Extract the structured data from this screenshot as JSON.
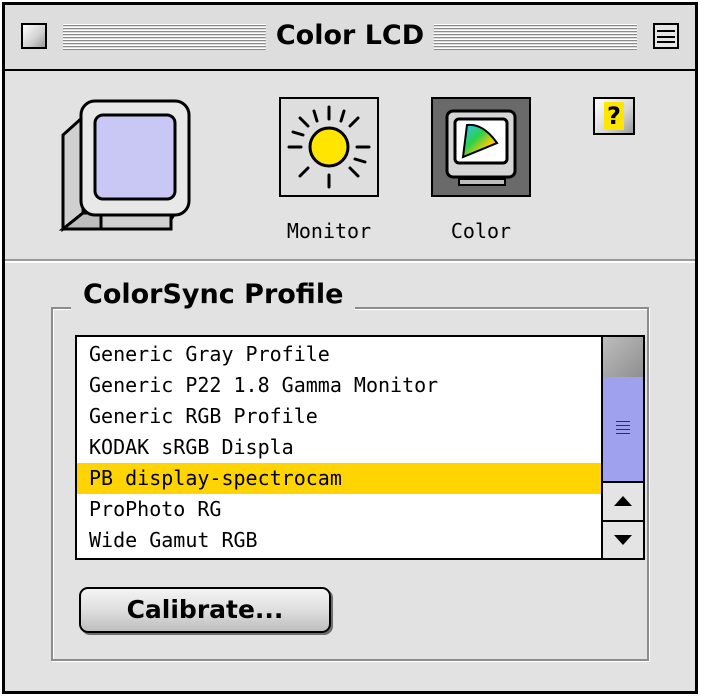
{
  "window": {
    "title": "Color LCD"
  },
  "toolbar": {
    "monitor_label": "Monitor",
    "color_label": "Color",
    "help_label": "?"
  },
  "colorsync": {
    "group_title": "ColorSync Profile",
    "profiles": [
      "Generic Gray Profile",
      "Generic P22 1.8 Gamma Monitor",
      "Generic RGB Profile",
      "KODAK sRGB Displa",
      "PB display-spectrocam",
      "ProPhoto RG",
      "Wide Gamut RGB"
    ],
    "selected_profile": "PB display-spectrocam",
    "calibrate_label": "Calibrate..."
  },
  "colors": {
    "selection": "#ffd400",
    "scroll_thumb": "#9fa0ee",
    "window_bg": "#e2e2e2"
  },
  "icons": {
    "monitor": "crt-monitor-icon",
    "brightness": "sun-icon",
    "color": "color-gamut-icon",
    "help": "help-icon"
  }
}
